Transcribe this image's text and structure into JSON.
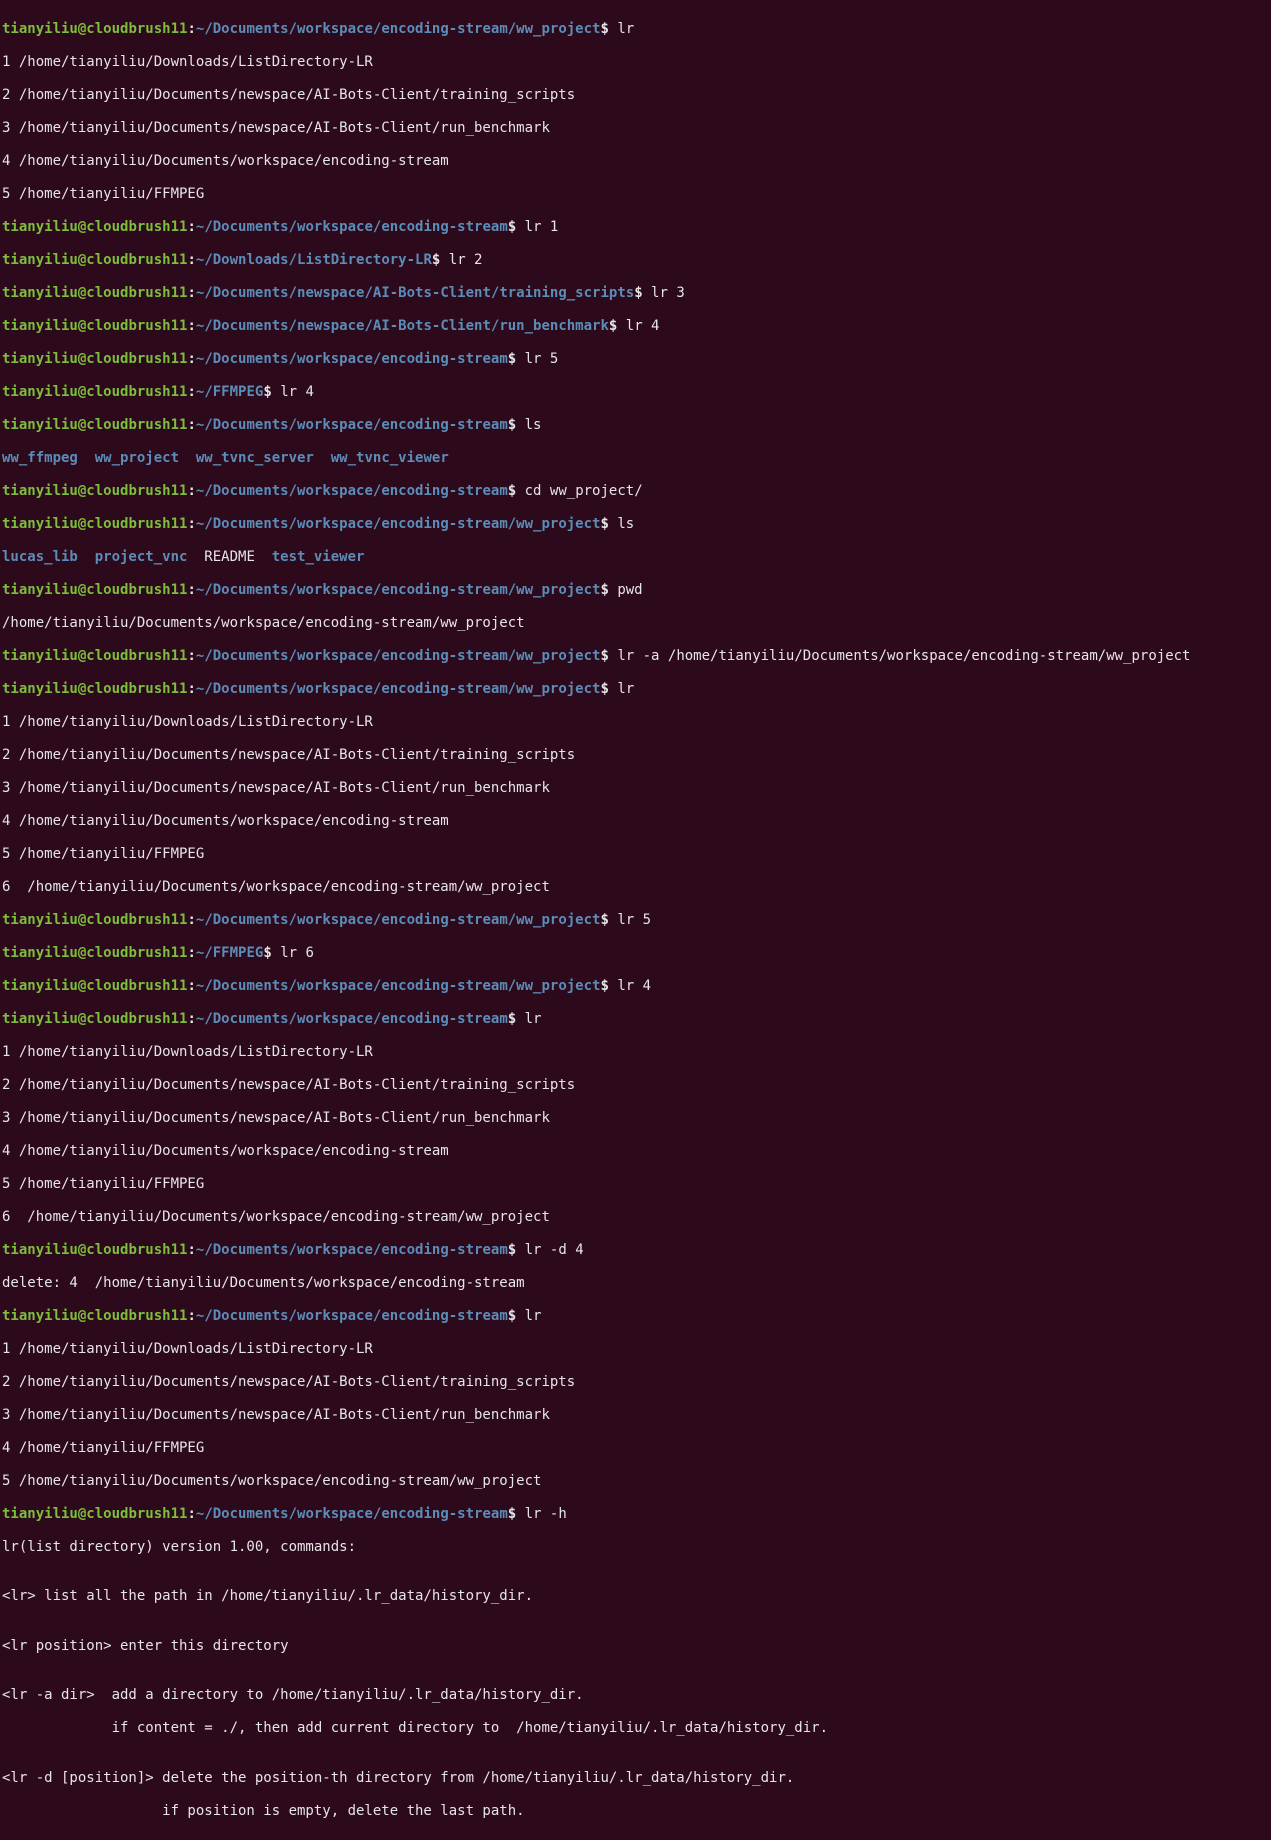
{
  "user": "tianyiliu",
  "host": "cloudbrush11",
  "paths": {
    "p_ww": "~/Documents/workspace/encoding-stream/ww_project",
    "p_es": "~/Documents/workspace/encoding-stream",
    "p_dl": "~/Downloads/ListDirectory-LR",
    "p_ts": "~/Documents/newspace/AI-Bots-Client/training_scripts",
    "p_rb": "~/Documents/newspace/AI-Bots-Client/run_benchmark",
    "p_ff": "~/FFMPEG"
  },
  "cmds": {
    "lr": "lr",
    "lr1": "lr 1",
    "lr2": "lr 2",
    "lr3": "lr 3",
    "lr4": "lr 4",
    "lr5": "lr 5",
    "lr6": "lr 6",
    "ls": "ls",
    "cd": "cd ww_project/",
    "pwd": "pwd",
    "lra": "lr -a /home/tianyiliu/Documents/workspace/encoding-stream/ww_project",
    "lrd4": "lr -d 4",
    "lrh": "lr -h"
  },
  "list5": {
    "l1": "1 /home/tianyiliu/Downloads/ListDirectory-LR",
    "l2": "2 /home/tianyiliu/Documents/newspace/AI-Bots-Client/training_scripts",
    "l3": "3 /home/tianyiliu/Documents/newspace/AI-Bots-Client/run_benchmark",
    "l4": "4 /home/tianyiliu/Documents/workspace/encoding-stream",
    "l5": "5 /home/tianyiliu/FFMPEG"
  },
  "list6": {
    "l1": "1 /home/tianyiliu/Downloads/ListDirectory-LR",
    "l2": "2 /home/tianyiliu/Documents/newspace/AI-Bots-Client/training_scripts",
    "l3": "3 /home/tianyiliu/Documents/newspace/AI-Bots-Client/run_benchmark",
    "l4": "4 /home/tianyiliu/Documents/workspace/encoding-stream",
    "l5": "5 /home/tianyiliu/FFMPEG",
    "l6": "6  /home/tianyiliu/Documents/workspace/encoding-stream/ww_project"
  },
  "list_after_del": {
    "l1": "1 /home/tianyiliu/Downloads/ListDirectory-LR",
    "l2": "2 /home/tianyiliu/Documents/newspace/AI-Bots-Client/training_scripts",
    "l3": "3 /home/tianyiliu/Documents/newspace/AI-Bots-Client/run_benchmark",
    "l4": "4 /home/tianyiliu/FFMPEG",
    "l5": "5 /home/tianyiliu/Documents/workspace/encoding-stream/ww_project"
  },
  "ls_es": {
    "a": "ww_ffmpeg",
    "b": "ww_project",
    "c": "ww_tvnc_server",
    "d": "ww_tvnc_viewer"
  },
  "ls_ww": {
    "a": "lucas_lib",
    "b": "project_vnc",
    "c": "README",
    "d": "test_viewer"
  },
  "pwd_out": "/home/tianyiliu/Documents/workspace/encoding-stream/ww_project",
  "del_out": "delete: 4  /home/tianyiliu/Documents/workspace/encoding-stream",
  "help": {
    "h1": "lr(list directory) version 1.00, commands:",
    "h2": "",
    "h3": "<lr> list all the path in /home/tianyiliu/.lr_data/history_dir.",
    "h4": "",
    "h5": "<lr position> enter this directory",
    "h6": "",
    "h7": "<lr -a dir>  add a directory to /home/tianyiliu/.lr_data/history_dir.",
    "h8": "             if content = ./, then add current directory to  /home/tianyiliu/.lr_data/history_dir.",
    "h9": "",
    "h10": "<lr -d [position]> delete the position-th directory from /home/tianyiliu/.lr_data/history_dir.",
    "h11": "                   if position is empty, delete the last path."
  }
}
